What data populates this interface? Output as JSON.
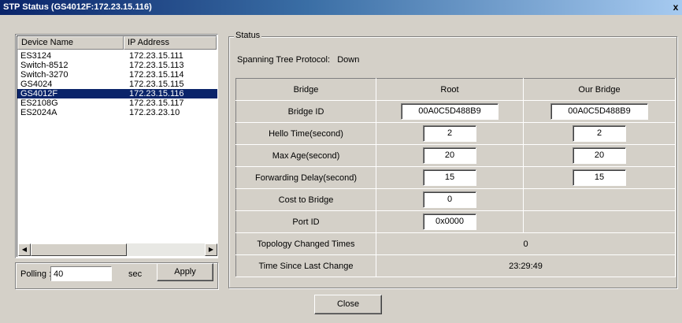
{
  "window": {
    "title": "STP Status (GS4012F:172.23.15.116)",
    "close_glyph": "x"
  },
  "device_list": {
    "columns": [
      "Device Name",
      "IP Address"
    ],
    "rows": [
      {
        "name": "ES3124",
        "ip": "172.23.15.111"
      },
      {
        "name": "Switch-8512",
        "ip": "172.23.15.113"
      },
      {
        "name": "Switch-3270",
        "ip": "172.23.15.114"
      },
      {
        "name": "GS4024",
        "ip": "172.23.15.115"
      },
      {
        "name": "GS4012F",
        "ip": "172.23.15.116"
      },
      {
        "name": "ES2108G",
        "ip": "172.23.15.117"
      },
      {
        "name": "ES2024A",
        "ip": "172.23.23.10"
      }
    ],
    "selected_index": 4
  },
  "polling": {
    "label": "Polling :",
    "value": "40",
    "unit": "sec",
    "apply_label": "Apply"
  },
  "status": {
    "legend": "Status",
    "stp_label": "Spanning Tree Protocol:",
    "stp_value": "Down",
    "header": {
      "bridge": "Bridge",
      "root": "Root",
      "our_bridge": "Our Bridge"
    },
    "bridge_id": {
      "label": "Bridge ID",
      "root": "00A0C5D488B9",
      "ours": "00A0C5D488B9"
    },
    "hello_time": {
      "label": "Hello Time(second)",
      "root": "2",
      "ours": "2"
    },
    "max_age": {
      "label": "Max Age(second)",
      "root": "20",
      "ours": "20"
    },
    "forward_delay": {
      "label": "Forwarding Delay(second)",
      "root": "15",
      "ours": "15"
    },
    "cost_to_bridge": {
      "label": "Cost to Bridge",
      "root": "0"
    },
    "port_id": {
      "label": "Port ID",
      "root": "0x0000"
    },
    "topology_changed": {
      "label": "Topology Changed Times",
      "value": "0"
    },
    "time_since_change": {
      "label": "Time Since Last Change",
      "value": "23:29:49"
    }
  },
  "close_label": "Close",
  "colors": {
    "title_start": "#0a246a",
    "title_end": "#a6caf0",
    "selection": "#0a246a",
    "face": "#d4d0c8"
  }
}
